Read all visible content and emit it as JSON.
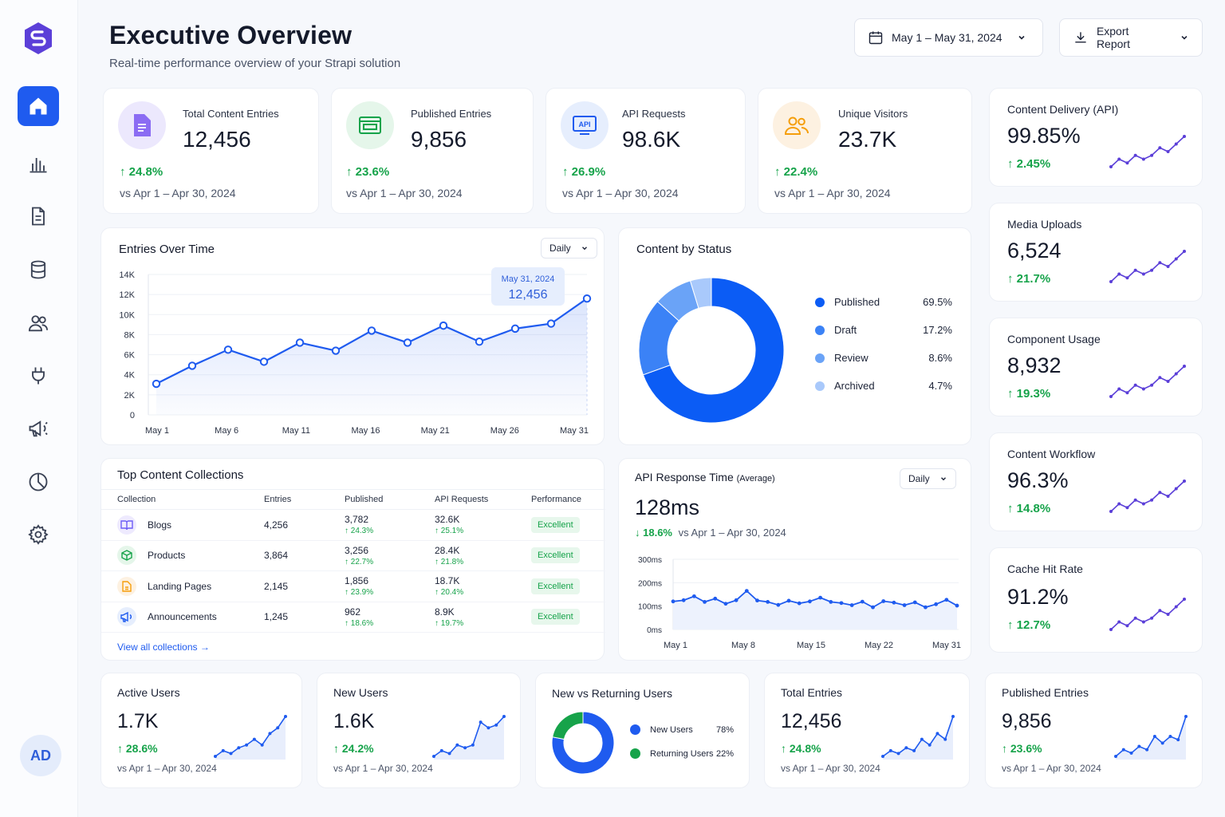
{
  "header": {
    "title": "Executive Overview",
    "subtitle": "Real-time performance overview of your Strapi solution",
    "date_range": "May 1 – May 31, 2024",
    "export_label": "Export Report"
  },
  "sidebar": {
    "items": [
      {
        "icon": "home-icon",
        "active": true
      },
      {
        "icon": "bar-chart-icon",
        "active": false
      },
      {
        "icon": "document-icon",
        "active": false
      },
      {
        "icon": "database-icon",
        "active": false
      },
      {
        "icon": "users-icon",
        "active": false
      },
      {
        "icon": "plug-icon",
        "active": false
      },
      {
        "icon": "megaphone-icon",
        "active": false
      },
      {
        "icon": "pie-chart-icon",
        "active": false
      },
      {
        "icon": "gear-icon",
        "active": false
      }
    ],
    "avatar": "AD",
    "accent": "#1f5bef"
  },
  "kpis": [
    {
      "label": "Total Content Entries",
      "value": "12,456",
      "change": "24.8%",
      "compare": "vs Apr 1 – Apr 30, 2024",
      "icon": "document-icon",
      "color": "#7c5cf0"
    },
    {
      "label": "Published Entries",
      "value": "9,856",
      "change": "23.6%",
      "compare": "vs Apr 1 – Apr 30, 2024",
      "icon": "newspaper-icon",
      "color": "#16a34a"
    },
    {
      "label": "API Requests",
      "value": "98.6K",
      "change": "26.9%",
      "compare": "vs Apr 1 – Apr 30, 2024",
      "icon": "api-icon",
      "color": "#1f5bef"
    },
    {
      "label": "Unique Visitors",
      "value": "23.7K",
      "change": "22.4%",
      "compare": "vs Apr 1 – Apr 30, 2024",
      "icon": "users-icon",
      "color": "#f59e0b"
    }
  ],
  "right_cards": [
    {
      "title": "Content Delivery (API)",
      "value": "99.85%",
      "change": "2.45%",
      "spark": [
        3,
        5,
        4,
        6,
        5,
        6,
        8,
        7,
        9,
        11
      ]
    },
    {
      "title": "Media Uploads",
      "value": "6,524",
      "change": "21.7%",
      "spark": [
        3,
        5,
        4,
        6,
        5,
        6,
        8,
        7,
        9,
        11
      ]
    },
    {
      "title": "Component Usage",
      "value": "8,932",
      "change": "19.3%",
      "spark": [
        3,
        5,
        4,
        6,
        5,
        6,
        8,
        7,
        9,
        11
      ]
    },
    {
      "title": "Content Workflow",
      "value": "96.3%",
      "change": "14.8%",
      "spark": [
        3,
        5,
        4,
        6,
        5,
        6,
        8,
        7,
        9,
        11
      ]
    },
    {
      "title": "Cache Hit Rate",
      "value": "91.2%",
      "change": "12.7%",
      "spark": [
        3,
        5,
        4,
        6,
        5,
        6,
        8,
        7,
        9,
        11
      ]
    }
  ],
  "entries_over_time": {
    "title": "Entries Over Time",
    "select": "Daily",
    "tooltip_date": "May 31, 2024",
    "tooltip_value": "12,456",
    "chart_data": {
      "type": "area",
      "x": [
        "May 1",
        "May 4",
        "May 6",
        "May 9",
        "May 11",
        "May 14",
        "May 16",
        "May 19",
        "May 21",
        "May 24",
        "May 26",
        "May 29",
        "May 31"
      ],
      "y": [
        3100,
        4900,
        6500,
        5300,
        7200,
        6400,
        8400,
        7200,
        8900,
        7300,
        8600,
        9100,
        11600
      ],
      "xticks": [
        "May 1",
        "May 6",
        "May 11",
        "May 16",
        "May 21",
        "May 26",
        "May 31"
      ],
      "yticks": [
        "0",
        "2K",
        "4K",
        "6K",
        "8K",
        "10K",
        "12K",
        "14K"
      ],
      "ylim": [
        0,
        14000
      ]
    }
  },
  "content_by_status": {
    "title": "Content by Status",
    "items": [
      {
        "label": "Published",
        "pct": "69.5%",
        "value": 69.5,
        "color": "#0b5cf5"
      },
      {
        "label": "Draft",
        "pct": "17.2%",
        "value": 17.2,
        "color": "#3b82f6"
      },
      {
        "label": "Review",
        "pct": "8.6%",
        "value": 8.6,
        "color": "#6aa3f7"
      },
      {
        "label": "Archived",
        "pct": "4.7%",
        "value": 4.7,
        "color": "#a9c9fb"
      }
    ]
  },
  "top_collections": {
    "title": "Top Content Collections",
    "columns": [
      "Collection",
      "Entries",
      "Published",
      "API Requests",
      "Performance"
    ],
    "rows": [
      {
        "name": "Blogs",
        "icon": "book-icon",
        "color": "#6d5df5",
        "entries": "4,256",
        "published": "3,782",
        "published_change": "↑ 24.3%",
        "api": "32.6K",
        "api_change": "↑ 25.1%",
        "perf": "Excellent"
      },
      {
        "name": "Products",
        "icon": "box-icon",
        "color": "#16a34a",
        "entries": "3,864",
        "published": "3,256",
        "published_change": "↑ 22.7%",
        "api": "28.4K",
        "api_change": "↑ 21.8%",
        "perf": "Excellent"
      },
      {
        "name": "Landing Pages",
        "icon": "file-icon",
        "color": "#f59e0b",
        "entries": "2,145",
        "published": "1,856",
        "published_change": "↑ 23.9%",
        "api": "18.7K",
        "api_change": "↑ 20.4%",
        "perf": "Excellent"
      },
      {
        "name": "Announcements",
        "icon": "megaphone-icon",
        "color": "#1f5bef",
        "entries": "1,245",
        "published": "962",
        "published_change": "↑ 18.6%",
        "api": "8.9K",
        "api_change": "↑ 19.7%",
        "perf": "Excellent"
      }
    ],
    "view_all": "View all collections →"
  },
  "api_response": {
    "title": "API Response Time",
    "title_note": "(Average)",
    "select": "Daily",
    "value": "128ms",
    "change": "18.6%",
    "compare": "vs Apr 1 – Apr 30, 2024",
    "chart_data": {
      "type": "area",
      "y": [
        120,
        125,
        142,
        118,
        132,
        110,
        125,
        165,
        124,
        118,
        105,
        123,
        112,
        120,
        136,
        118,
        113,
        104,
        119,
        95,
        121,
        115,
        104,
        116,
        95,
        108,
        127,
        102
      ],
      "xticks": [
        "May 1",
        "May 8",
        "May 15",
        "May 22",
        "May 31"
      ],
      "yticks": [
        "0ms",
        "100ms",
        "200ms",
        "300ms"
      ],
      "ylim": [
        0,
        300
      ]
    }
  },
  "bottom_cards": [
    {
      "title": "Active Users",
      "value": "1.7K",
      "change": "28.6%",
      "compare": "vs Apr 1 – Apr 30, 2024",
      "spark": [
        2,
        3,
        2.5,
        3.5,
        4,
        5,
        4,
        6,
        7,
        9
      ]
    },
    {
      "title": "New Users",
      "value": "1.6K",
      "change": "24.2%",
      "compare": "vs Apr 1 – Apr 30, 2024",
      "spark": [
        2,
        3,
        2.5,
        4,
        3.5,
        4,
        8,
        7,
        7.5,
        9
      ]
    },
    {
      "title": "Total Entries",
      "value": "12,456",
      "change": "24.8%",
      "compare": "vs Apr 1 – Apr 30, 2024",
      "spark": [
        2,
        3,
        2.5,
        3.5,
        3,
        5,
        4,
        6,
        5,
        9
      ]
    },
    {
      "title": "Published Entries",
      "value": "9,856",
      "change": "23.6%",
      "compare": "vs Apr 1 – Apr 30, 2024",
      "spark": [
        2,
        3,
        2.5,
        3.5,
        3,
        5,
        4,
        5,
        4.5,
        8
      ]
    }
  ],
  "new_vs_returning": {
    "title": "New vs Returning Users",
    "items": [
      {
        "label": "New Users",
        "pct": "78%",
        "value": 78,
        "color": "#1f5bef"
      },
      {
        "label": "Returning Users",
        "pct": "22%",
        "value": 22,
        "color": "#16a34a"
      }
    ]
  },
  "colors": {
    "positive": "#16a34a",
    "spark": "#5b3fd8",
    "line": "#1f5bef"
  }
}
